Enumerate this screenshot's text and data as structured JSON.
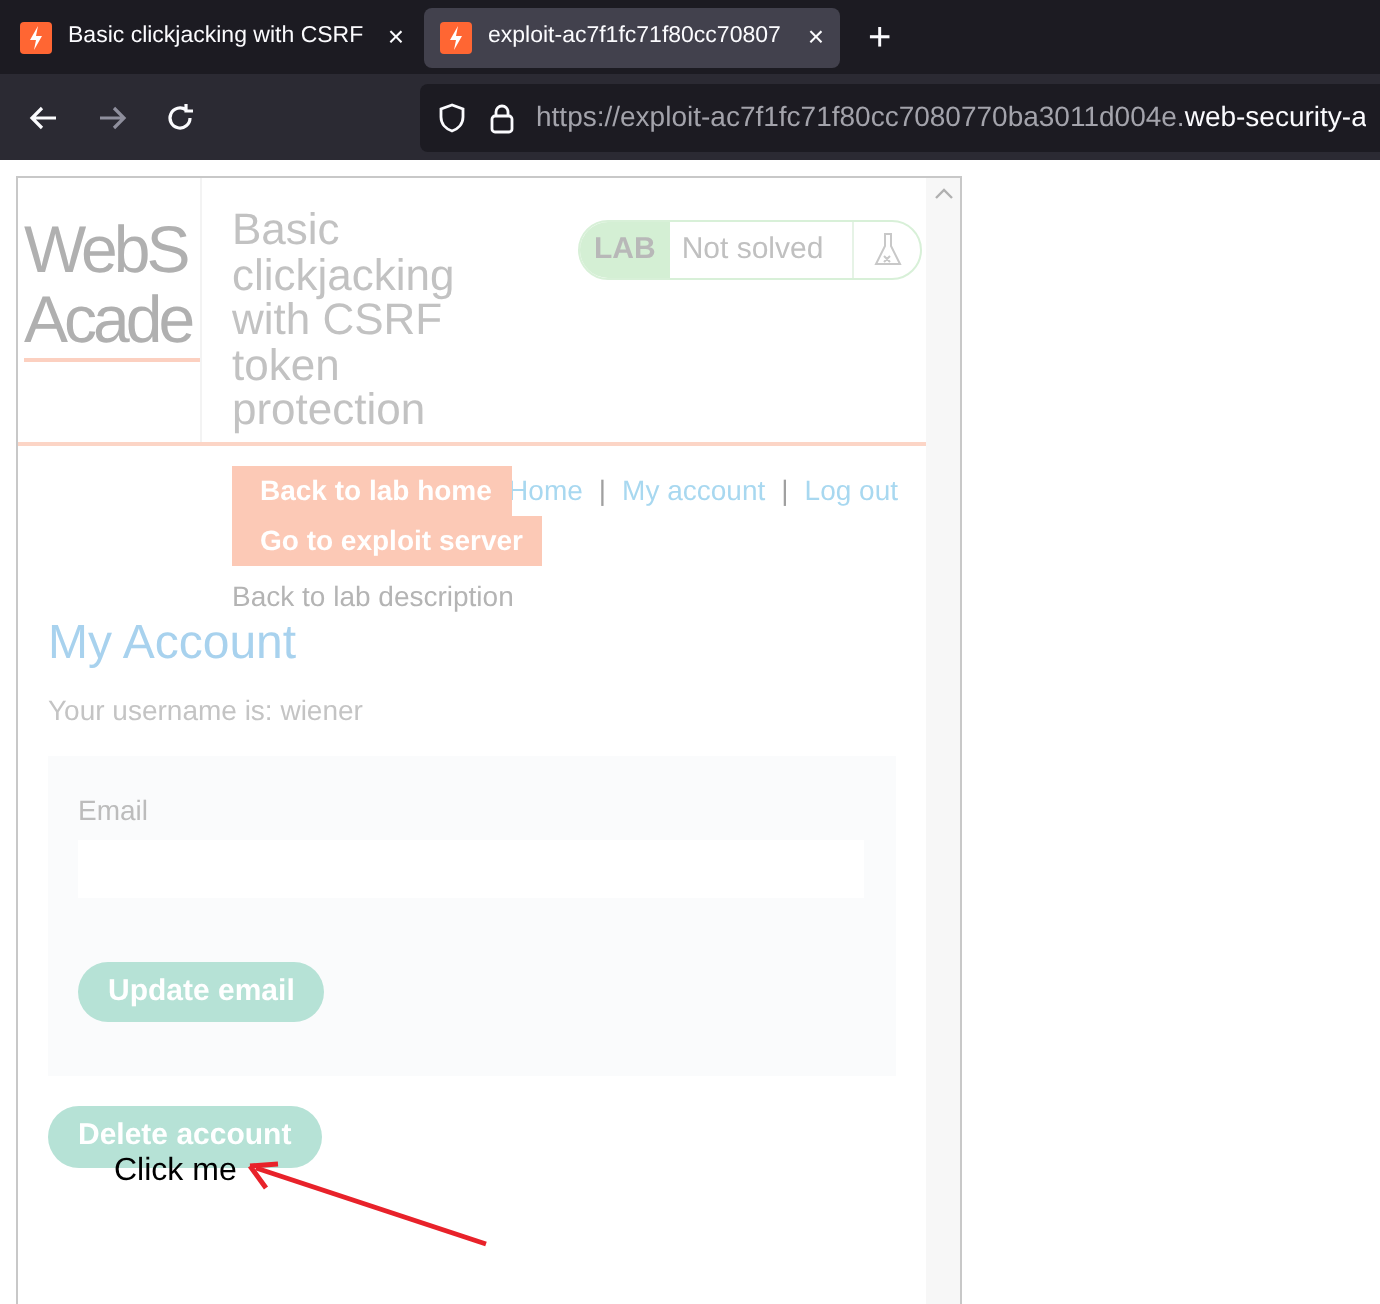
{
  "browser": {
    "tabs": [
      {
        "title": "Basic clickjacking with CSRF",
        "close": "×",
        "selected": false
      },
      {
        "title": "exploit-ac7f1fc71f80cc70807",
        "close": "×",
        "selected": true
      }
    ],
    "new_tab": "+",
    "url": {
      "subdomain": "https://exploit-ac7f1fc71f80cc7080770ba3011d004e.",
      "domain": "web-security-a"
    }
  },
  "page": {
    "logo": [
      "WebS",
      "Acade"
    ],
    "title": "Basic clickjacking with CSRF token protection",
    "lab_badge": {
      "label": "LAB",
      "status": "Not solved"
    },
    "header_buttons": [
      "Back to lab home",
      "Go to exploit server"
    ],
    "nav": [
      {
        "kind": "link",
        "text": "Home"
      },
      {
        "kind": "separator",
        "text": "|"
      },
      {
        "kind": "link",
        "text": "My account"
      },
      {
        "kind": "separator",
        "text": "|"
      },
      {
        "kind": "link",
        "text": "Log out"
      }
    ],
    "back_link": "Back to lab description",
    "heading": "My Account",
    "username_text": "Your username is: wiener",
    "email_label": "Email",
    "update_button": "Update email",
    "delete_button": "Delete account"
  },
  "overlay": {
    "decoy": "Click me"
  }
}
